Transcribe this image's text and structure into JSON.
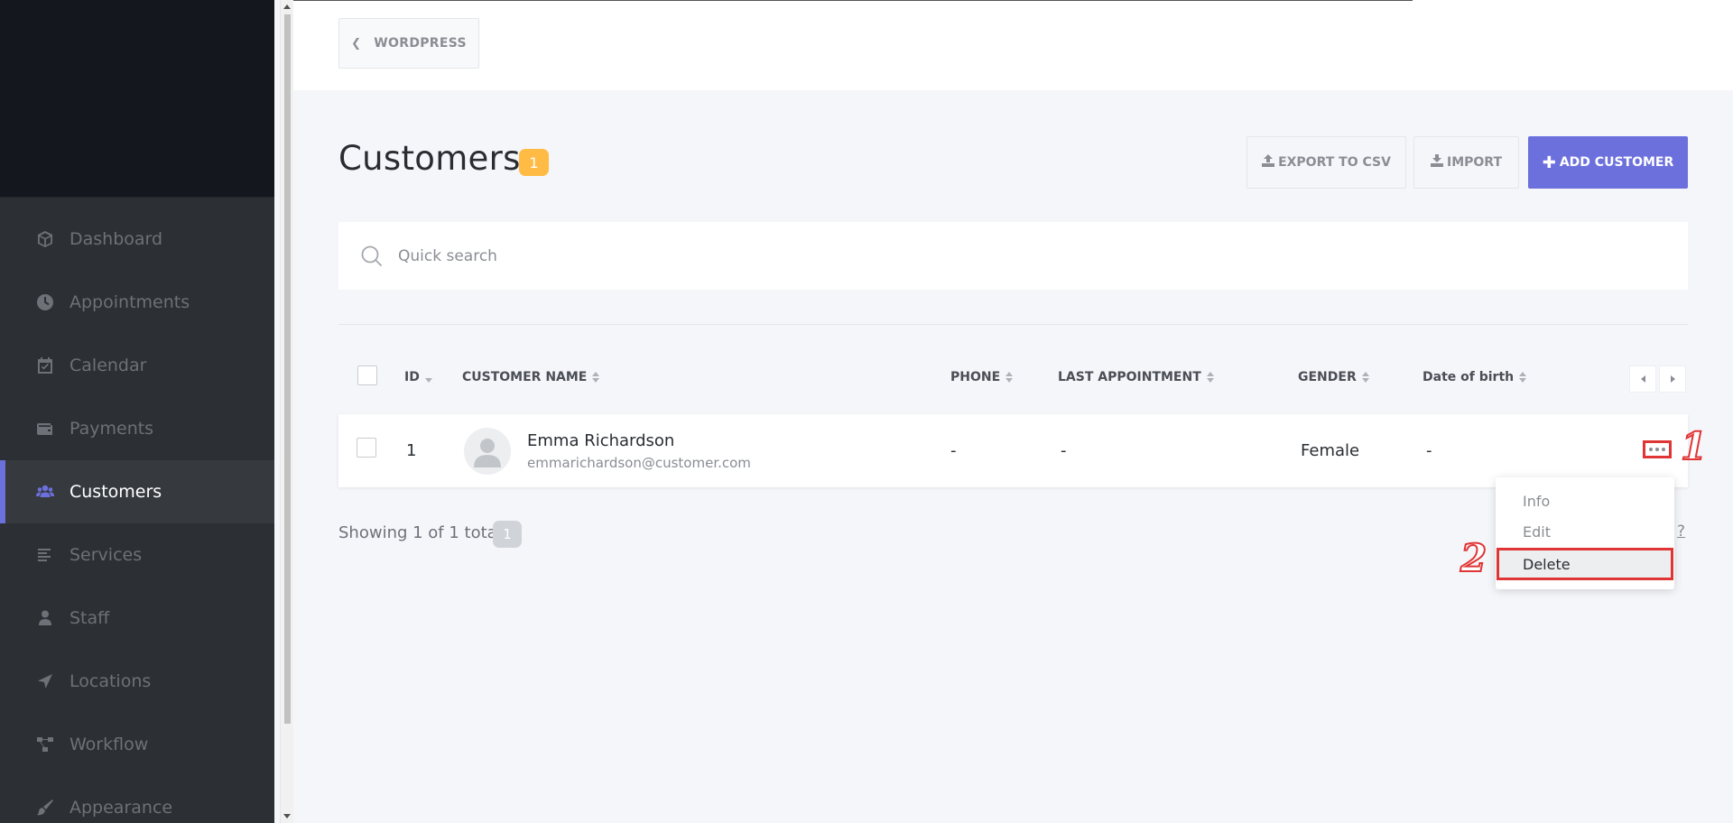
{
  "sidebar": {
    "items": [
      {
        "label": "Dashboard",
        "icon": "cube-icon"
      },
      {
        "label": "Appointments",
        "icon": "clock-icon"
      },
      {
        "label": "Calendar",
        "icon": "calendar-icon"
      },
      {
        "label": "Payments",
        "icon": "wallet-icon"
      },
      {
        "label": "Customers",
        "icon": "users-icon",
        "active": true
      },
      {
        "label": "Services",
        "icon": "list-icon"
      },
      {
        "label": "Staff",
        "icon": "user-icon"
      },
      {
        "label": "Locations",
        "icon": "location-arrow-icon"
      },
      {
        "label": "Workflow",
        "icon": "workflow-icon"
      },
      {
        "label": "Appearance",
        "icon": "brush-icon"
      }
    ]
  },
  "topbar": {
    "back_label": "WORDPRESS"
  },
  "header": {
    "title": "Customers",
    "count": "1",
    "export_label": "EXPORT TO CSV",
    "import_label": "IMPORT",
    "add_label": "ADD CUSTOMER"
  },
  "search": {
    "placeholder": "Quick search"
  },
  "table": {
    "columns": [
      "ID",
      "CUSTOMER NAME",
      "PHONE",
      "LAST APPOINTMENT",
      "GENDER",
      "Date of birth"
    ],
    "rows": [
      {
        "id": "1",
        "name": "Emma Richardson",
        "email": "emmarichardson@customer.com",
        "phone": "-",
        "last_appointment": "-",
        "gender": "Female",
        "dob": "-"
      }
    ]
  },
  "footer": {
    "showing": "Showing 1 of 1 total",
    "count": "1",
    "help": "?"
  },
  "menu": {
    "info": "Info",
    "edit": "Edit",
    "delete": "Delete"
  },
  "annotations": {
    "step1": "1",
    "step2": "2"
  },
  "colors": {
    "accent": "#6c70dc",
    "badge": "#ffbb44",
    "highlight": "#e03535",
    "sidebar": "#2c2f33"
  }
}
